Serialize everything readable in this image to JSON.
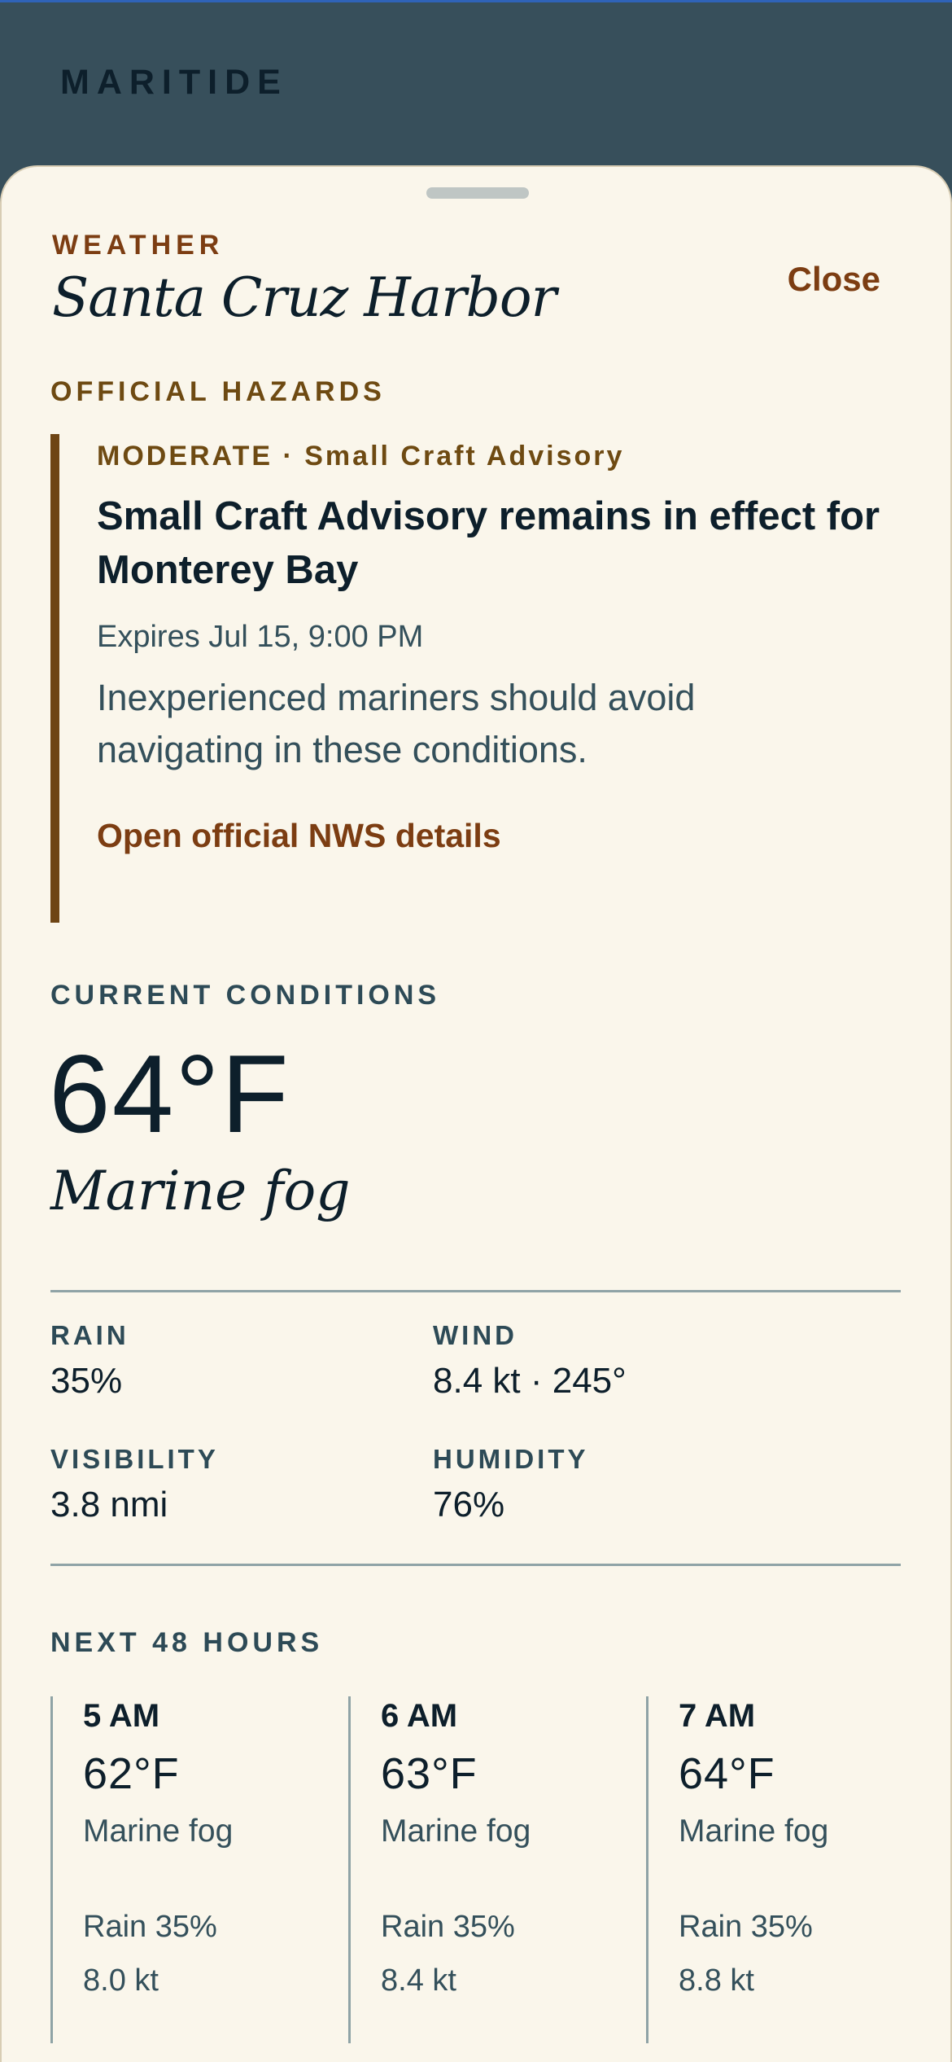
{
  "app": {
    "brand": "MARITIDE"
  },
  "sheet": {
    "eyebrow": "WEATHER",
    "location": "Santa Cruz Harbor",
    "close_label": "Close"
  },
  "hazards": {
    "section_label": "OFFICIAL HAZARDS",
    "items": [
      {
        "severity_line": "MODERATE · Small Craft Advisory",
        "headline": "Small Craft Advisory remains in effect for Monterey Bay",
        "expires": "Expires Jul 15, 9:00 PM",
        "description": "Inexperienced mariners should avoid navigating in these conditions.",
        "link_label": "Open official NWS details"
      }
    ]
  },
  "current": {
    "section_label": "CURRENT CONDITIONS",
    "temperature": "64°F",
    "condition": "Marine fog",
    "stats": [
      {
        "label": "RAIN",
        "value": "35%"
      },
      {
        "label": "WIND",
        "value": "8.4 kt · 245°"
      },
      {
        "label": "VISIBILITY",
        "value": "3.8 nmi"
      },
      {
        "label": "HUMIDITY",
        "value": "76%"
      }
    ]
  },
  "forecast": {
    "section_label": "NEXT 48 HOURS",
    "hours": [
      {
        "time": "5 AM",
        "temp": "62°F",
        "condition": "Marine fog",
        "rain": "Rain 35%",
        "wind": "8.0 kt"
      },
      {
        "time": "6 AM",
        "temp": "63°F",
        "condition": "Marine fog",
        "rain": "Rain 35%",
        "wind": "8.4 kt"
      },
      {
        "time": "7 AM",
        "temp": "64°F",
        "condition": "Marine fog",
        "rain": "Rain 35%",
        "wind": "8.8 kt"
      }
    ]
  },
  "colors": {
    "header_bg": "#374f5b",
    "sheet_bg": "#faf6eb",
    "accent": "#7c3d12",
    "hazard_bar": "#6e4514",
    "ink": "#0d1f2b"
  }
}
